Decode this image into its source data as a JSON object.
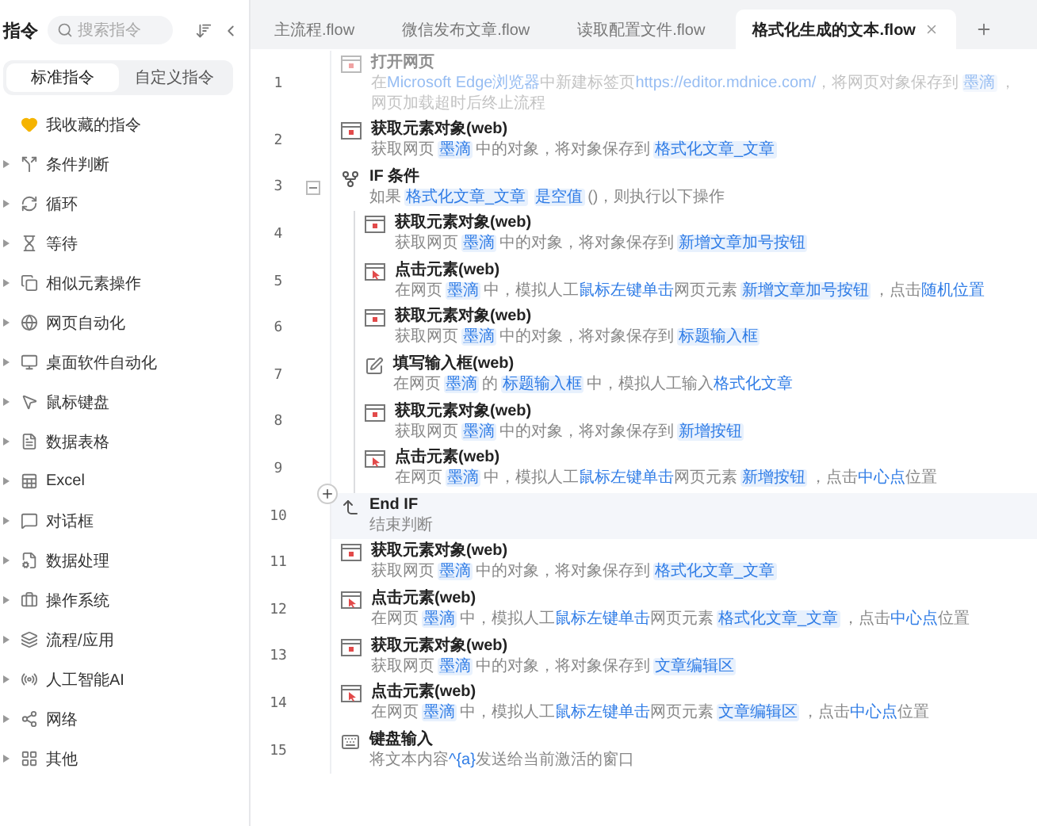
{
  "sidebar": {
    "title": "指令",
    "search": {
      "placeholder": "搜索指令"
    },
    "tabs": [
      {
        "label": "标准指令",
        "selected": true
      },
      {
        "label": "自定义指令",
        "selected": false
      }
    ],
    "items": [
      {
        "label": "我收藏的指令",
        "kind": "heart"
      },
      {
        "label": "条件判断",
        "kind": "branch",
        "expanded": false
      },
      {
        "label": "循环",
        "kind": "loop",
        "expanded": false
      },
      {
        "label": "等待",
        "kind": "hourglass",
        "expanded": false
      },
      {
        "label": "相似元素操作",
        "kind": "copy",
        "expanded": false
      },
      {
        "label": "网页自动化",
        "kind": "globe",
        "expanded": false
      },
      {
        "label": "桌面软件自动化",
        "kind": "monitor",
        "expanded": false
      },
      {
        "label": "鼠标键盘",
        "kind": "pointer",
        "expanded": false
      },
      {
        "label": "数据表格",
        "kind": "file",
        "expanded": false
      },
      {
        "label": "Excel",
        "kind": "sheet",
        "expanded": false
      },
      {
        "label": "对话框",
        "kind": "message",
        "expanded": false
      },
      {
        "label": "数据处理",
        "kind": "filecog",
        "expanded": false
      },
      {
        "label": "操作系统",
        "kind": "briefcase",
        "expanded": false
      },
      {
        "label": "流程/应用",
        "kind": "layers",
        "expanded": false
      },
      {
        "label": "人工智能AI",
        "kind": "radio",
        "expanded": false
      },
      {
        "label": "网络",
        "kind": "share",
        "expanded": false
      },
      {
        "label": "其他",
        "kind": "grid",
        "expanded": false
      }
    ]
  },
  "file_tabs": [
    {
      "label": "主流程.flow",
      "selected": false
    },
    {
      "label": "微信发布文章.flow",
      "selected": false
    },
    {
      "label": "读取配置文件.flow",
      "selected": false
    },
    {
      "label": "格式化生成的文本.flow",
      "selected": true
    }
  ],
  "steps": [
    {
      "line": "1",
      "kind": "open",
      "title": "打开网页",
      "disabled": true,
      "selected": false,
      "desc": [
        {
          "kind": "plain",
          "text": "在"
        },
        {
          "kind": "link",
          "text": "Microsoft Edge浏览器"
        },
        {
          "kind": "plain",
          "text": "中新建标签页"
        },
        {
          "kind": "link",
          "text": "https://editor.mdnice.com/"
        },
        {
          "kind": "plain",
          "text": "，将网页对象保存到"
        },
        {
          "kind": "var",
          "text": "墨滴"
        },
        {
          "kind": "plain",
          "text": "，网页加载超时后终止流程"
        }
      ]
    },
    {
      "line": "2",
      "kind": "get",
      "title": "获取元素对象(web)",
      "disabled": false,
      "selected": false,
      "desc": [
        {
          "kind": "plain",
          "text": "获取网页"
        },
        {
          "kind": "var",
          "text": "墨滴"
        },
        {
          "kind": "plain",
          "text": "中的对象，将对象保存到"
        },
        {
          "kind": "var",
          "text": "格式化文章_文章"
        }
      ]
    },
    {
      "line": "3",
      "kind": "if",
      "title": "IF 条件",
      "disabled": false,
      "selected": false,
      "expanded": true,
      "desc": [
        {
          "kind": "plain",
          "text": "如果"
        },
        {
          "kind": "var",
          "text": "格式化文章_文章"
        },
        {
          "kind": "var",
          "text": "是空值"
        },
        {
          "kind": "plain",
          "text": "()，则执行以下操作"
        }
      ],
      "children": [
        {
          "line": "4",
          "kind": "get",
          "title": "获取元素对象(web)",
          "disabled": false,
          "selected": false,
          "desc": [
            {
              "kind": "plain",
              "text": "获取网页"
            },
            {
              "kind": "var",
              "text": "墨滴"
            },
            {
              "kind": "plain",
              "text": "中的对象，将对象保存到"
            },
            {
              "kind": "var",
              "text": "新增文章加号按钮"
            }
          ]
        },
        {
          "line": "5",
          "kind": "click",
          "title": "点击元素(web)",
          "disabled": false,
          "selected": false,
          "desc": [
            {
              "kind": "plain",
              "text": "在网页"
            },
            {
              "kind": "var",
              "text": "墨滴"
            },
            {
              "kind": "plain",
              "text": "中，模拟人工"
            },
            {
              "kind": "link",
              "text": "鼠标左键单击"
            },
            {
              "kind": "plain",
              "text": "网页元素"
            },
            {
              "kind": "var",
              "text": "新增文章加号按钮"
            },
            {
              "kind": "plain",
              "text": "，点击"
            },
            {
              "kind": "link",
              "text": "随机位置"
            }
          ]
        },
        {
          "line": "6",
          "kind": "get",
          "title": "获取元素对象(web)",
          "disabled": false,
          "selected": false,
          "desc": [
            {
              "kind": "plain",
              "text": "获取网页"
            },
            {
              "kind": "var",
              "text": "墨滴"
            },
            {
              "kind": "plain",
              "text": "中的对象，将对象保存到"
            },
            {
              "kind": "var",
              "text": "标题输入框"
            }
          ]
        },
        {
          "line": "7",
          "kind": "fill",
          "title": "填写输入框(web)",
          "disabled": false,
          "selected": false,
          "desc": [
            {
              "kind": "plain",
              "text": "在网页"
            },
            {
              "kind": "var",
              "text": "墨滴"
            },
            {
              "kind": "plain",
              "text": "的"
            },
            {
              "kind": "var",
              "text": "标题输入框"
            },
            {
              "kind": "plain",
              "text": "中，模拟人工输入"
            },
            {
              "kind": "link",
              "text": "格式化文章"
            }
          ]
        },
        {
          "line": "8",
          "kind": "get",
          "title": "获取元素对象(web)",
          "disabled": false,
          "selected": false,
          "desc": [
            {
              "kind": "plain",
              "text": "获取网页"
            },
            {
              "kind": "var",
              "text": "墨滴"
            },
            {
              "kind": "plain",
              "text": "中的对象，将对象保存到"
            },
            {
              "kind": "var",
              "text": "新增按钮"
            }
          ]
        },
        {
          "line": "9",
          "kind": "click",
          "title": "点击元素(web)",
          "disabled": false,
          "selected": false,
          "desc": [
            {
              "kind": "plain",
              "text": "在网页"
            },
            {
              "kind": "var",
              "text": "墨滴"
            },
            {
              "kind": "plain",
              "text": "中，模拟人工"
            },
            {
              "kind": "link",
              "text": "鼠标左键单击"
            },
            {
              "kind": "plain",
              "text": "网页元素"
            },
            {
              "kind": "var",
              "text": "新增按钮"
            },
            {
              "kind": "plain",
              "text": "，点击"
            },
            {
              "kind": "link",
              "text": "中心点"
            },
            {
              "kind": "plain",
              "text": "位置"
            }
          ]
        }
      ]
    },
    {
      "line": "10",
      "kind": "endif",
      "title": "End IF",
      "disabled": false,
      "selected": true,
      "desc": [
        {
          "kind": "plain",
          "text": "结束判断"
        }
      ]
    },
    {
      "line": "11",
      "kind": "get",
      "title": "获取元素对象(web)",
      "disabled": false,
      "selected": false,
      "desc": [
        {
          "kind": "plain",
          "text": "获取网页"
        },
        {
          "kind": "var",
          "text": "墨滴"
        },
        {
          "kind": "plain",
          "text": "中的对象，将对象保存到"
        },
        {
          "kind": "var",
          "text": "格式化文章_文章"
        }
      ]
    },
    {
      "line": "12",
      "kind": "click",
      "title": "点击元素(web)",
      "disabled": false,
      "selected": false,
      "desc": [
        {
          "kind": "plain",
          "text": "在网页"
        },
        {
          "kind": "var",
          "text": "墨滴"
        },
        {
          "kind": "plain",
          "text": "中，模拟人工"
        },
        {
          "kind": "link",
          "text": "鼠标左键单击"
        },
        {
          "kind": "plain",
          "text": "网页元素"
        },
        {
          "kind": "var",
          "text": "格式化文章_文章"
        },
        {
          "kind": "plain",
          "text": "，点击"
        },
        {
          "kind": "link",
          "text": "中心点"
        },
        {
          "kind": "plain",
          "text": "位置"
        }
      ]
    },
    {
      "line": "13",
      "kind": "get",
      "title": "获取元素对象(web)",
      "disabled": false,
      "selected": false,
      "desc": [
        {
          "kind": "plain",
          "text": "获取网页"
        },
        {
          "kind": "var",
          "text": "墨滴"
        },
        {
          "kind": "plain",
          "text": "中的对象，将对象保存到"
        },
        {
          "kind": "var",
          "text": "文章编辑区"
        }
      ]
    },
    {
      "line": "14",
      "kind": "click",
      "title": "点击元素(web)",
      "disabled": false,
      "selected": false,
      "desc": [
        {
          "kind": "plain",
          "text": "在网页"
        },
        {
          "kind": "var",
          "text": "墨滴"
        },
        {
          "kind": "plain",
          "text": "中，模拟人工"
        },
        {
          "kind": "link",
          "text": "鼠标左键单击"
        },
        {
          "kind": "plain",
          "text": "网页元素"
        },
        {
          "kind": "var",
          "text": "文章编辑区"
        },
        {
          "kind": "plain",
          "text": "，点击"
        },
        {
          "kind": "link",
          "text": "中心点"
        },
        {
          "kind": "plain",
          "text": "位置"
        }
      ]
    },
    {
      "line": "15",
      "kind": "keyboard",
      "title": "键盘输入",
      "disabled": false,
      "selected": false,
      "desc": [
        {
          "kind": "plain",
          "text": "将文本内容"
        },
        {
          "kind": "link",
          "text": "^{a}"
        },
        {
          "kind": "plain",
          "text": "发送给当前激活的窗口"
        }
      ]
    }
  ]
}
